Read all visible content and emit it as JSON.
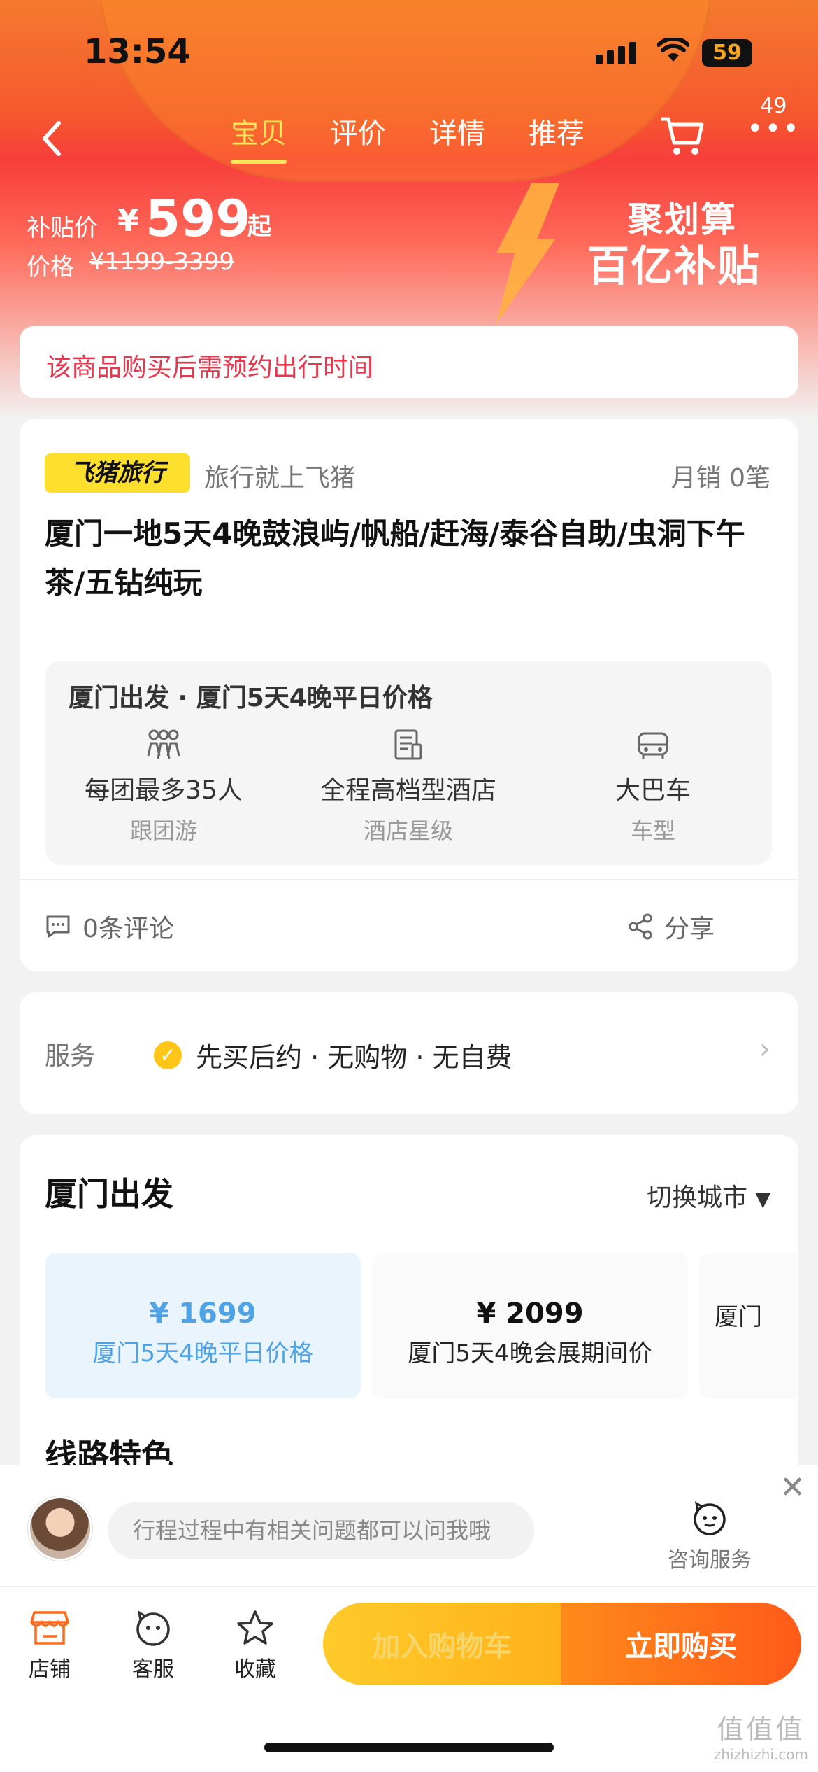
{
  "status_bar": {
    "time": "13:54",
    "battery": "59"
  },
  "nav": {
    "tabs": [
      {
        "label": "宝贝",
        "active": true
      },
      {
        "label": "评价",
        "active": false
      },
      {
        "label": "详情",
        "active": false
      },
      {
        "label": "推荐",
        "active": false
      }
    ],
    "more_count": "49"
  },
  "promo": {
    "subsidy_label": "补贴价",
    "currency": "¥",
    "subsidy_price": "599",
    "subsidy_suffix": "起",
    "original_label": "价格",
    "original_price": "¥1199-3399",
    "brand_line1": "聚划算",
    "brand_line2": "百亿补贴"
  },
  "notice": "该商品购买后需预约出行时间",
  "product": {
    "shop_badge": "飞猪旅行",
    "slogan": "旅行就上飞猪",
    "monthly_sales": "月销 0笔",
    "title": "厦门一地5天4晚鼓浪屿/帆船/赶海/泰谷自助/虫洞下午茶/五钻纯玩",
    "info_header": "厦门出发 · 厦门5天4晚平日价格",
    "features": [
      {
        "icon": "group-icon",
        "value": "每团最多35人",
        "key": "跟团游"
      },
      {
        "icon": "hotel-document-icon",
        "value": "全程高档型酒店",
        "key": "酒店星级"
      },
      {
        "icon": "bus-icon",
        "value": "大巴车",
        "key": "车型"
      }
    ],
    "comments": "0条评论",
    "share": "分享"
  },
  "service": {
    "label": "服务",
    "text": "先买后约 · 无购物 · 无自费"
  },
  "departure": {
    "title": "厦门出发",
    "switch_city": "切换城市",
    "options": [
      {
        "price": "¥ 1699",
        "name": "厦门5天4晚平日价格",
        "selected": true
      },
      {
        "price": "¥ 2099",
        "name": "厦门5天4晚会展期间价",
        "selected": false
      },
      {
        "price": "",
        "name": "厦门",
        "selected": false
      }
    ],
    "route_title": "线路特色"
  },
  "chat": {
    "placeholder": "行程过程中有相关问题都可以问我哦",
    "consult_label": "咨询服务"
  },
  "bottom": {
    "shop": "店铺",
    "service": "客服",
    "favorite": "收藏",
    "add_cart": "加入购物车",
    "buy_now": "立即购买"
  },
  "watermark": {
    "line1": "值值值",
    "line2": "zhizhizhi.com"
  },
  "colors": {
    "accent_orange": "#ff5a1a",
    "accent_yellow": "#ffe35a",
    "notice_red": "#e8364d",
    "selected_blue": "#4ea2e6"
  }
}
